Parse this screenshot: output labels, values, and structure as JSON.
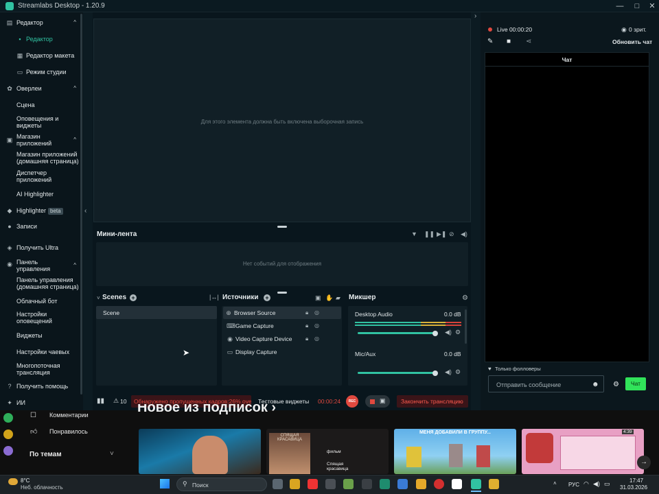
{
  "window": {
    "title": "Streamlabs Desktop - 1.20.9",
    "minimize": "—",
    "maximize": "□",
    "close": "✕"
  },
  "sidebar": {
    "items": [
      {
        "label": "Редактор",
        "icon": "editor-icon",
        "chev": "^"
      },
      {
        "label": "Редактор",
        "active": true
      },
      {
        "label": "Редактор макета"
      },
      {
        "label": "Режим студии"
      },
      {
        "label": "Оверлеи",
        "icon": "overlays-icon",
        "chev": "^"
      },
      {
        "label": "Сцена"
      },
      {
        "label": "Оповещения и виджеты"
      },
      {
        "label": "Магазин приложений",
        "icon": "store-icon",
        "chev": "^"
      },
      {
        "label": "Магазин приложений (домашняя страница)"
      },
      {
        "label": "Диспетчер приложений"
      },
      {
        "label": "AI Highlighter"
      },
      {
        "label": "Highlighter",
        "badge": "beta"
      },
      {
        "label": "Записи",
        "icon": "recordings-icon"
      },
      {
        "label": "Получить Ultra",
        "icon": "ultra-icon"
      },
      {
        "label": "Панель управления",
        "icon": "dashboard-icon",
        "chev": "^"
      },
      {
        "label": "Панель управления (домашняя страница)"
      },
      {
        "label": "Облачный бот"
      },
      {
        "label": "Настройки оповещений"
      },
      {
        "label": "Виджеты"
      },
      {
        "label": "Настройки чаевых"
      },
      {
        "label": "Многопоточная трансляция"
      },
      {
        "label": "Получить помощь",
        "icon": "help-icon"
      },
      {
        "label": "ИИ",
        "icon": "ai-icon"
      }
    ]
  },
  "preview": {
    "message": "Для этого элемента должна быть включена выборочная запись"
  },
  "minifeed": {
    "title": "Мини-лента",
    "empty": "Нет событий для отображения"
  },
  "scenes": {
    "title": "Scenes",
    "items": [
      "Scene"
    ]
  },
  "sources": {
    "title": "Источники",
    "items": [
      "Browser Source",
      "Game Capture",
      "Video Capture Device",
      "Display Capture"
    ]
  },
  "mixer": {
    "title": "Микшер",
    "channels": [
      {
        "name": "Desktop Audio",
        "db": "0.0 dB",
        "level": 0.96
      },
      {
        "name": "Mic/Aux",
        "db": "0.0 dB",
        "level": 0.96
      }
    ]
  },
  "bottombar": {
    "warn_count": "10",
    "warning": "Обнаружено пропущенных кадров:26% ove",
    "test_widgets": "Тестовые виджеты",
    "timer": "00:00:24",
    "rec": "REC",
    "end_stream": "Закончить трансляцию"
  },
  "right": {
    "live": "Live 00:00:20",
    "viewers": "0 зрит.",
    "refresh": "Обновить чат",
    "chat_tab": "Чат",
    "followers_only": "Только фолловеры",
    "placeholder": "Отправить сообщение",
    "send": "Чат"
  },
  "web": {
    "comments": "Комментарии",
    "liked": "Понравилось",
    "topics": "По темам",
    "headline": "Новое из подписок ›",
    "thumb2_title": "СПЯЩАЯ КРАСАВИЦА",
    "thumb2_tag": "фильм",
    "thumb2_sub": "Спящая красавица",
    "thumb3_title": "МЕНЯ ДОБАВИЛИ В ГРУППУ...",
    "thumb4_time": "4:39"
  },
  "taskbar": {
    "temp": "8°C",
    "weather": "Неб. облачность",
    "search": "Поиск",
    "lang": "РУС",
    "time": "17:47",
    "date": "31.03.2026"
  }
}
